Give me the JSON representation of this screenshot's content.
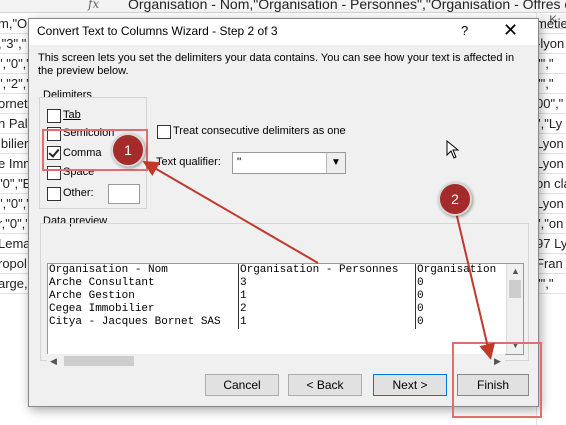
{
  "excel": {
    "formula_fx": "fx",
    "formula": "Organisation - Nom,\"Organisation - Personnes\",\"Organisation - Offres en",
    "col_k": "K",
    "left_cells": [
      "m,\"Or",
      ",\"3\",\"",
      "\",\"0\",\"",
      "\",\"2\",\"",
      "ornet",
      "n Pall",
      "ibilier",
      "e Imm",
      "\"0\",\"E",
      "\",\"0\",\"",
      "r,\"0\",\"",
      "Lemai",
      "ropol",
      "arge,\""
    ],
    "right_cells": [
      "metie",
      "-lyon",
      "\"\",\"",
      "\"\",\"",
      "00\",\"",
      "\",\"Ly",
      "Lyon",
      "Lyon",
      "on cla",
      "Lyon",
      "\",\"on",
      "97 Ly",
      "Fran",
      "\"\",\""
    ]
  },
  "dialog": {
    "title": "Convert Text to Columns Wizard - Step 2 of 3",
    "help": "?",
    "close": "✕",
    "description": "This screen lets you set the delimiters your data contains.  You can see how your text is affected in the preview below.",
    "delimiters_label": "Delimiters",
    "delimiters": [
      {
        "label": "Tab",
        "checked": false
      },
      {
        "label": "Semicolon",
        "checked": false
      },
      {
        "label": "Comma",
        "checked": true
      },
      {
        "label": "Space",
        "checked": false
      },
      {
        "label": "Other:",
        "checked": false
      }
    ],
    "treat_consecutive": "Treat consecutive delimiters as one",
    "text_qualifier_label": "Text qualifier:",
    "text_qualifier_value": "\"",
    "data_preview_label": "Data preview",
    "preview_rows": [
      [
        "Organisation - Nom",
        "Organisation - Personnes",
        "Organisation"
      ],
      [
        "Arche Consultant",
        "3",
        "0"
      ],
      [
        "Arche Gestion",
        "1",
        "0"
      ],
      [
        "Cegea Immobilier",
        "2",
        "0"
      ],
      [
        "Citya - Jacques Bornet SAS",
        "1",
        "0"
      ]
    ],
    "buttons": {
      "cancel": "Cancel",
      "back": "< Back",
      "next": "Next >",
      "finish": "Finish"
    }
  },
  "annotations": {
    "badge1": "1",
    "badge2": "2",
    "color": "#a52a2a",
    "highlight_color": "#e36c6c"
  }
}
